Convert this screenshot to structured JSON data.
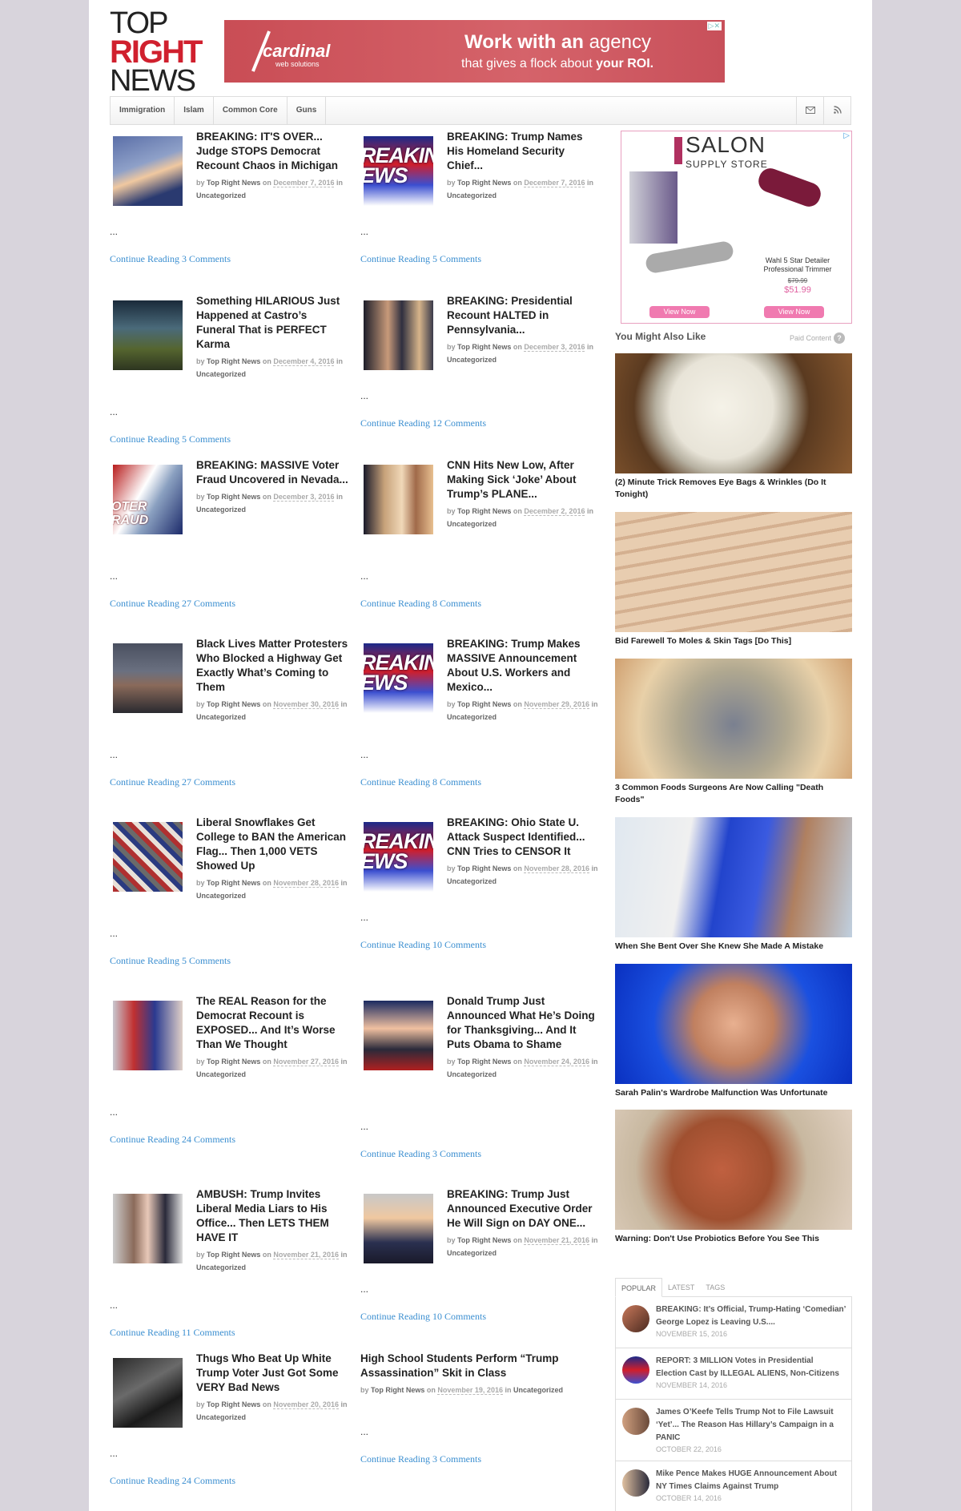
{
  "site": {
    "logo_lines": [
      "TOP",
      "RIGHT",
      "NEWS"
    ]
  },
  "banner_ad": {
    "brand": "cardinal",
    "brand_sub": "web solutions",
    "headline_a": "Work with an",
    "headline_b": " agency",
    "sub_a": "that gives a flock about ",
    "sub_b": "your ROI.",
    "ad_choices": "▷✕"
  },
  "nav": {
    "items": [
      "Immigration",
      "Islam",
      "Common Core",
      "Guns"
    ],
    "icons": [
      "envelope-icon",
      "rss-icon"
    ]
  },
  "posts": [
    {
      "title": "BREAKING: IT'S OVER... Judge STOPS Democrat Recount Chaos in Michigan",
      "author": "Top Right News",
      "date": "December 7, 2016",
      "category": "Uncategorized",
      "comments": "Continue Reading 3 Comments"
    },
    {
      "title": "BREAKING: Trump Names His Homeland Security Chief...",
      "author": "Top Right News",
      "date": "December 7, 2016",
      "category": "Uncategorized",
      "comments": "Continue Reading 5 Comments"
    },
    {
      "title": "Something HILARIOUS Just Happened at Castro’s Funeral That is PERFECT Karma",
      "author": "Top Right News",
      "date": "December 4, 2016",
      "category": "Uncategorized",
      "comments": "Continue Reading 5 Comments"
    },
    {
      "title": "BREAKING: Presidential Recount HALTED in Pennsylvania...",
      "author": "Top Right News",
      "date": "December 3, 2016",
      "category": "Uncategorized",
      "comments": "Continue Reading 12 Comments"
    },
    {
      "title": "BREAKING: MASSIVE Voter Fraud Uncovered in Nevada...",
      "author": "Top Right News",
      "date": "December 3, 2016",
      "category": "Uncategorized",
      "comments": "Continue Reading 27 Comments"
    },
    {
      "title": "CNN Hits New Low, After Making Sick ‘Joke’ About Trump’s PLANE...",
      "author": "Top Right News",
      "date": "December 2, 2016",
      "category": "Uncategorized",
      "comments": "Continue Reading 8 Comments"
    },
    {
      "title": "Black Lives Matter Protesters Who Blocked a Highway Get Exactly What’s Coming to Them",
      "author": "Top Right News",
      "date": "November 30, 2016",
      "category": "Uncategorized",
      "comments": "Continue Reading 27 Comments"
    },
    {
      "title": "BREAKING: Trump Makes MASSIVE Announcement About U.S. Workers and Mexico...",
      "author": "Top Right News",
      "date": "November 29, 2016",
      "category": "Uncategorized",
      "comments": "Continue Reading 8 Comments"
    },
    {
      "title": "Liberal Snowflakes Get College to BAN the American Flag... Then 1,000 VETS Showed Up",
      "author": "Top Right News",
      "date": "November 28, 2016",
      "category": "Uncategorized",
      "comments": "Continue Reading 5 Comments"
    },
    {
      "title": "BREAKING: Ohio State U. Attack Suspect Identified... CNN Tries to CENSOR It",
      "author": "Top Right News",
      "date": "November 28, 2016",
      "category": "Uncategorized",
      "comments": "Continue Reading 10 Comments"
    },
    {
      "title": "The REAL Reason for the Democrat Recount is EXPOSED... And It’s Worse Than We Thought",
      "author": "Top Right News",
      "date": "November 27, 2016",
      "category": "Uncategorized",
      "comments": "Continue Reading 24 Comments"
    },
    {
      "title": "Donald Trump Just Announced What He’s Doing for Thanksgiving... And It Puts Obama to Shame",
      "author": "Top Right News",
      "date": "November 24, 2016",
      "category": "Uncategorized",
      "comments": "Continue Reading 3 Comments"
    },
    {
      "title": "AMBUSH: Trump Invites Liberal Media Liars to His Office... Then LETS THEM HAVE IT",
      "author": "Top Right News",
      "date": "November 21, 2016",
      "category": "Uncategorized",
      "comments": "Continue Reading 11 Comments"
    },
    {
      "title": "BREAKING: Trump Just Announced Executive Order He Will Sign on DAY ONE...",
      "author": "Top Right News",
      "date": "November 21, 2016",
      "category": "Uncategorized",
      "comments": "Continue Reading 10 Comments"
    },
    {
      "title": "Thugs Who Beat Up White Trump Voter Just Got Some VERY Bad News",
      "author": "Top Right News",
      "date": "November 20, 2016",
      "category": "Uncategorized",
      "comments": "Continue Reading 24 Comments"
    },
    {
      "title": "High School Students Perform “Trump Assassination” Skit in Class",
      "author": "Top Right News",
      "date": "November 19, 2016",
      "category": "Uncategorized",
      "comments": "Continue Reading 3 Comments"
    }
  ],
  "meta_words": {
    "by": "by",
    "on": "on",
    "in": "in",
    "ellipsis": "..."
  },
  "thumb_text": {
    "breaking": "REAKIN\nEWS",
    "voter": "OTER\nRAUD"
  },
  "salon_ad": {
    "logo": "SALON",
    "logo_sub": "SUPPLY STORE",
    "product": "Wahl 5 Star Detailer Professional Trimmer",
    "old_price": "$79.99",
    "new_price": "$51.99",
    "button1": "View Now",
    "button2": "View Now",
    "ad_choices": "▷"
  },
  "you_might_like": {
    "heading": "You Might Also Like",
    "paid": "Paid Content",
    "paid_icon": "?",
    "items": [
      "(2) Minute Trick Removes Eye Bags & Wrinkles (Do It Tonight)",
      "Bid Farewell To Moles & Skin Tags [Do This]",
      "3 Common Foods Surgeons Are Now Calling \"Death Foods\"",
      "When She Bent Over She Knew She Made A Mistake",
      "Sarah Palin's Wardrobe Malfunction Was Unfortunate",
      "Warning: Don't Use Probiotics Before You See This"
    ]
  },
  "tabs": {
    "labels": [
      "POPULAR",
      "LATEST",
      "TAGS"
    ],
    "items": [
      {
        "title": "BREAKING: It’s Official, Trump-Hating ‘Comedian’ George Lopez is Leaving U.S....",
        "date": "NOVEMBER 15, 2016"
      },
      {
        "title": "REPORT: 3 MILLION Votes in Presidential Election Cast by ILLEGAL ALIENS, Non-Citizens",
        "date": "NOVEMBER 14, 2016"
      },
      {
        "title": "James O’Keefe Tells Trump Not to File Lawsuit ‘Yet’... The Reason Has Hillary’s Campaign in a PANIC",
        "date": "OCTOBER 22, 2016"
      },
      {
        "title": "Mike Pence Makes HUGE Announcement About NY Times Claims Against Trump",
        "date": "OCTOBER 14, 2016"
      }
    ]
  }
}
